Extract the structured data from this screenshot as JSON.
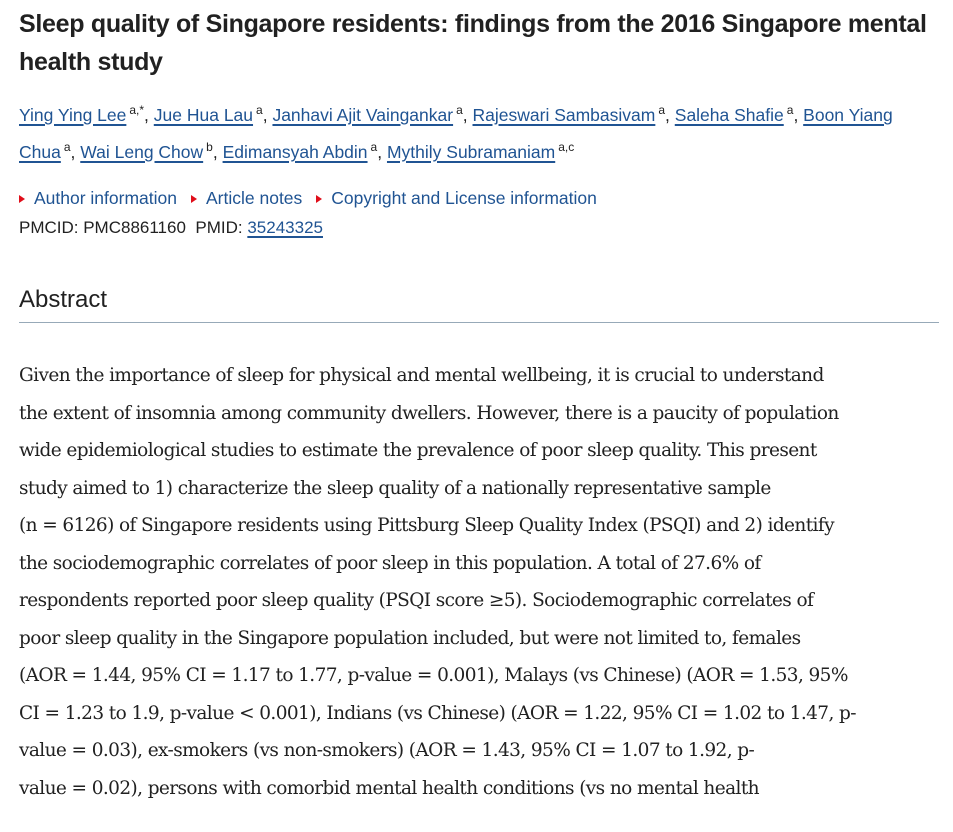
{
  "article": {
    "title": "Sleep quality of Singapore residents: findings from the 2016 Singapore mental health study",
    "authors": [
      {
        "name": "Ying Ying Lee",
        "aff": "a,*"
      },
      {
        "name": "Jue Hua Lau",
        "aff": "a"
      },
      {
        "name": "Janhavi Ajit Vaingankar",
        "aff": "a"
      },
      {
        "name": "Rajeswari Sambasivam",
        "aff": "a"
      },
      {
        "name": "Saleha Shafie",
        "aff": "a"
      },
      {
        "name": "Boon Yiang Chua",
        "aff": "a"
      },
      {
        "name": "Wai Leng Chow",
        "aff": "b"
      },
      {
        "name": "Edimansyah Abdin",
        "aff": "a"
      },
      {
        "name": "Mythily Subramaniam",
        "aff": "a,c"
      }
    ],
    "separator": ", ",
    "accordion": [
      {
        "label": "Author information"
      },
      {
        "label": "Article notes"
      },
      {
        "label": "Copyright and License information"
      }
    ],
    "ids": {
      "pmcid_label": "PMCID: PMC8861160",
      "pmid_label": "PMID:",
      "pmid_value": "35243325"
    }
  },
  "abstract": {
    "heading": "Abstract",
    "lines": [
      "Given the importance of sleep for physical and mental wellbeing, it is crucial to understand",
      "the extent of insomnia among community dwellers. However, there is a paucity of population",
      "wide epidemiological studies to estimate the prevalence of poor sleep quality. This present",
      "study aimed to 1) characterize the sleep quality of a nationally representative sample",
      "(n = 6126) of Singapore residents using Pittsburg Sleep Quality Index (PSQI) and 2) identify",
      "the sociodemographic correlates of poor sleep in this population. A total of 27.6% of",
      "respondents reported poor sleep quality (PSQI score ≥5). Sociodemographic correlates of",
      "poor sleep quality in the Singapore population included, but were not limited to, females",
      "(AOR = 1.44, 95% CI = 1.17 to 1.77, p-value = 0.001), Malays (vs Chinese) (AOR = 1.53, 95%",
      "CI = 1.23 to 1.9, p-value < 0.001), Indians (vs Chinese) (AOR = 1.22, 95% CI = 1.02 to 1.47, p-",
      "value = 0.03), ex-smokers (vs non-smokers) (AOR = 1.43, 95% CI = 1.07 to 1.92, p-",
      "value = 0.02), persons with comorbid mental health conditions (vs no mental health"
    ]
  }
}
